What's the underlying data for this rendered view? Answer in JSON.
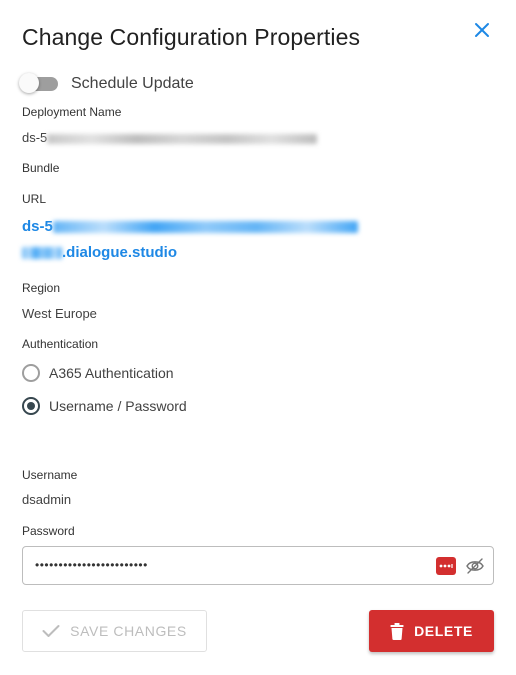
{
  "dialog": {
    "title": "Change Configuration Properties",
    "close_icon": "close-icon"
  },
  "schedule": {
    "label": "Schedule Update",
    "enabled": false
  },
  "deployment": {
    "label": "Deployment Name",
    "value_prefix": "ds-5"
  },
  "bundle": {
    "label": "Bundle"
  },
  "url": {
    "label": "URL",
    "line1_prefix": "ds-5",
    "line2_suffix": ".dialogue.studio"
  },
  "region": {
    "label": "Region",
    "value": "West Europe"
  },
  "authentication": {
    "label": "Authentication",
    "options": [
      {
        "label": "A365 Authentication",
        "selected": false
      },
      {
        "label": "Username / Password",
        "selected": true
      }
    ]
  },
  "username": {
    "label": "Username",
    "value": "dsadmin"
  },
  "password": {
    "label": "Password",
    "masked_value": "••••••••••••••••••••••••"
  },
  "actions": {
    "save_label": "SAVE CHANGES",
    "delete_label": "DELETE"
  },
  "colors": {
    "accent": "#1e88e5",
    "danger": "#d32f2f",
    "disabled": "#bdbdbd"
  }
}
